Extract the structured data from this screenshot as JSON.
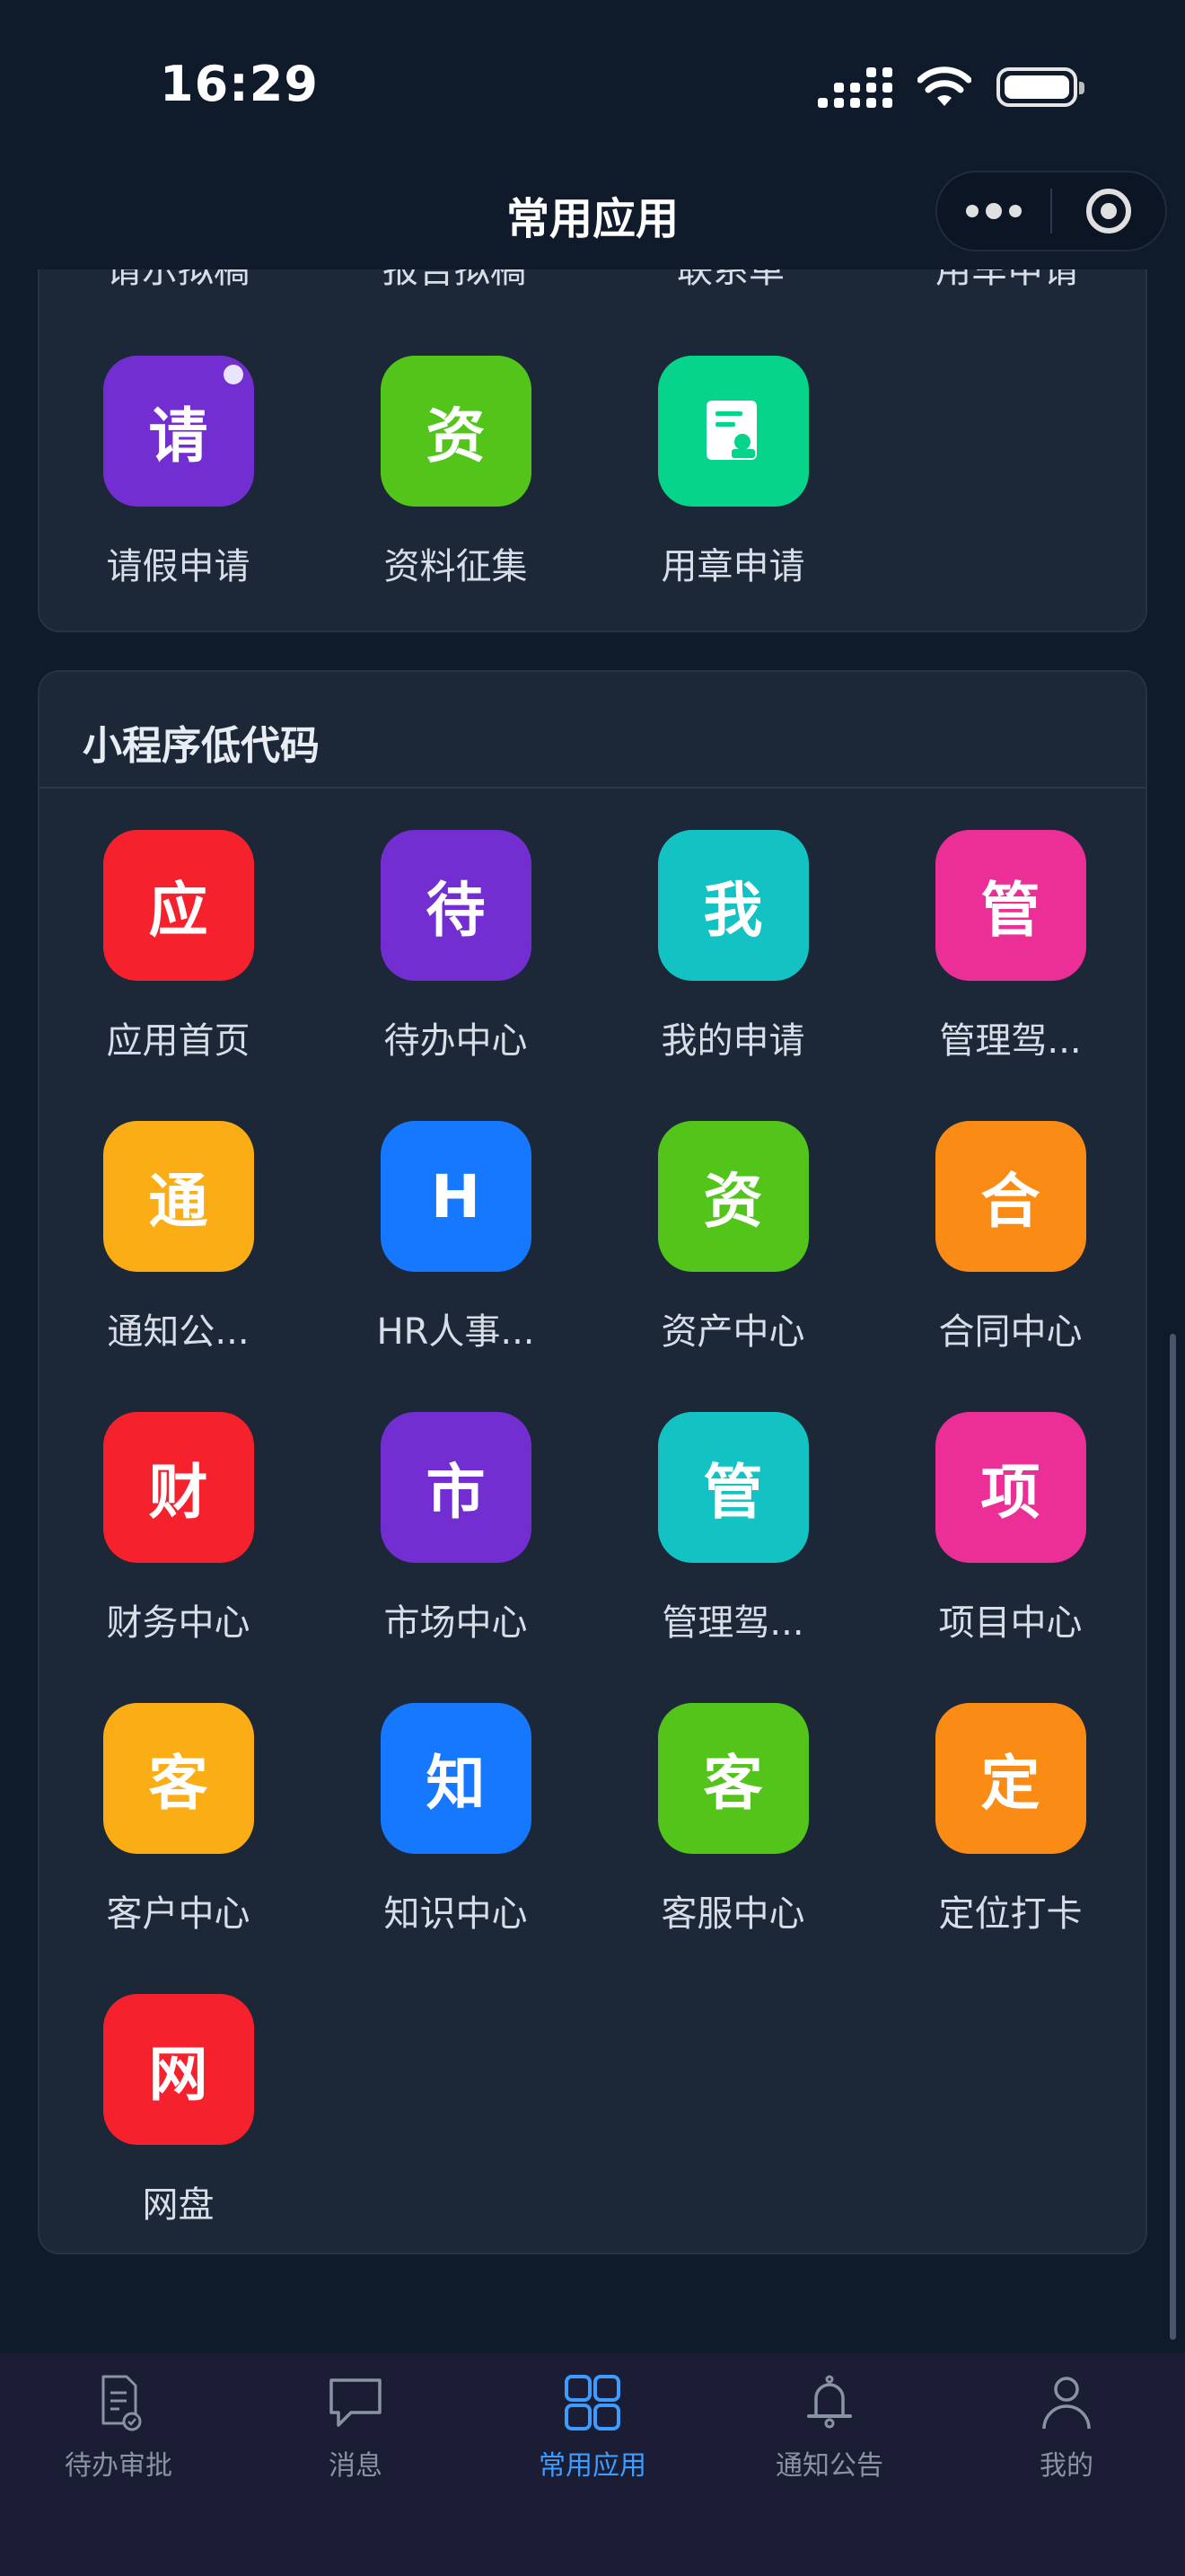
{
  "status_bar": {
    "time": "16:29"
  },
  "header": {
    "title": "常用应用"
  },
  "top_section": {
    "cut_labels": [
      "请示拟稿",
      "报告拟稿",
      "联系单",
      "用车申请"
    ],
    "apps": [
      {
        "icon_text": "请",
        "label": "请假申请",
        "color": "#722ed1"
      },
      {
        "icon_text": "资",
        "label": "资料征集",
        "color": "#52c41a"
      },
      {
        "icon_text": "",
        "label": "用章申请",
        "color": "#06d48a",
        "icon": "seal-document-icon"
      }
    ]
  },
  "lowcode_section": {
    "title": "小程序低代码",
    "apps": [
      {
        "icon_text": "应",
        "label": "应用首页",
        "color": "#f5222d"
      },
      {
        "icon_text": "待",
        "label": "待办中心",
        "color": "#722ed1"
      },
      {
        "icon_text": "我",
        "label": "我的申请",
        "color": "#13c2c2"
      },
      {
        "icon_text": "管",
        "label": "管理驾...",
        "color": "#eb2f96"
      },
      {
        "icon_text": "通",
        "label": "通知公...",
        "color": "#faad14"
      },
      {
        "icon_text": "H",
        "label": "HR人事...",
        "color": "#1677ff"
      },
      {
        "icon_text": "资",
        "label": "资产中心",
        "color": "#52c41a"
      },
      {
        "icon_text": "合",
        "label": "合同中心",
        "color": "#fa8c16"
      },
      {
        "icon_text": "财",
        "label": "财务中心",
        "color": "#f5222d"
      },
      {
        "icon_text": "市",
        "label": "市场中心",
        "color": "#722ed1"
      },
      {
        "icon_text": "管",
        "label": "管理驾...",
        "color": "#13c2c2"
      },
      {
        "icon_text": "项",
        "label": "项目中心",
        "color": "#eb2f96"
      },
      {
        "icon_text": "客",
        "label": "客户中心",
        "color": "#faad14"
      },
      {
        "icon_text": "知",
        "label": "知识中心",
        "color": "#1677ff"
      },
      {
        "icon_text": "客",
        "label": "客服中心",
        "color": "#52c41a"
      },
      {
        "icon_text": "定",
        "label": "定位打卡",
        "color": "#fa8c16"
      },
      {
        "icon_text": "网",
        "label": "网盘",
        "color": "#f5222d"
      }
    ]
  },
  "tab_bar": {
    "active_color": "#3c9cff",
    "items": [
      {
        "label": "待办审批",
        "icon": "approval-document-icon"
      },
      {
        "label": "消息",
        "icon": "chat-bubble-icon"
      },
      {
        "label": "常用应用",
        "icon": "app-grid-icon",
        "active": true
      },
      {
        "label": "通知公告",
        "icon": "bell-icon"
      },
      {
        "label": "我的",
        "icon": "user-icon"
      }
    ]
  }
}
